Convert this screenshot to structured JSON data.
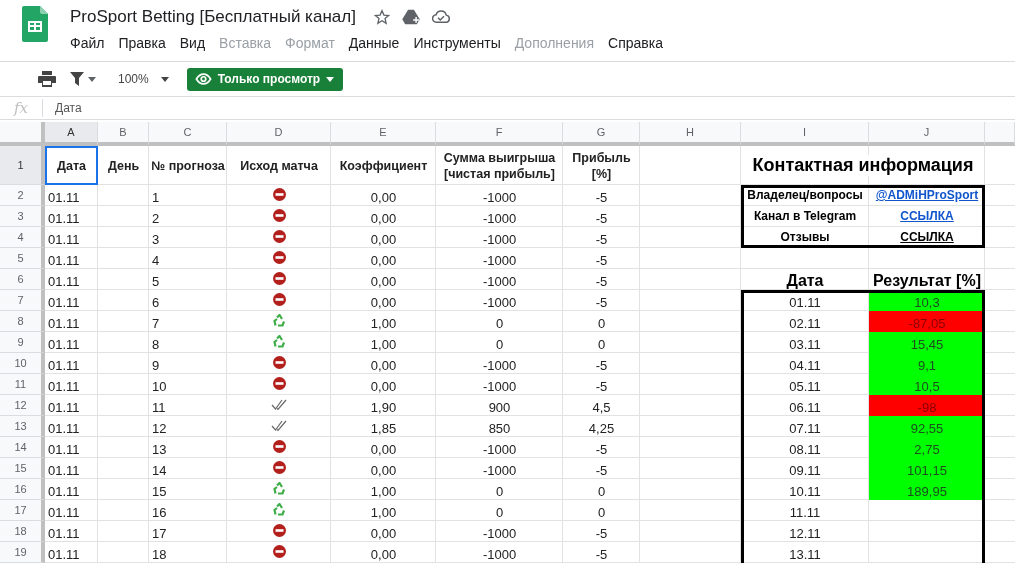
{
  "document": {
    "title": "ProSport Betting [Бесплатный канал]"
  },
  "menu": [
    {
      "label": "Файл",
      "disabled": false
    },
    {
      "label": "Правка",
      "disabled": false
    },
    {
      "label": "Вид",
      "disabled": false
    },
    {
      "label": "Вставка",
      "disabled": true
    },
    {
      "label": "Формат",
      "disabled": true
    },
    {
      "label": "Данные",
      "disabled": false
    },
    {
      "label": "Инструменты",
      "disabled": false
    },
    {
      "label": "Дополнения",
      "disabled": true
    },
    {
      "label": "Справка",
      "disabled": false
    }
  ],
  "toolbar": {
    "zoom": "100%",
    "mode_button": "Только просмотр"
  },
  "formula_bar": {
    "label": "fx",
    "value": "Дата"
  },
  "sheet": {
    "columns": [
      {
        "label": "A",
        "selected": true
      },
      {
        "label": "B",
        "selected": false
      },
      {
        "label": "C",
        "selected": false
      },
      {
        "label": "D",
        "selected": false
      },
      {
        "label": "E",
        "selected": false
      },
      {
        "label": "F",
        "selected": false
      },
      {
        "label": "G",
        "selected": false
      },
      {
        "label": "H",
        "selected": false
      },
      {
        "label": "I",
        "selected": false
      },
      {
        "label": "J",
        "selected": false
      }
    ],
    "row_numbers": [
      {
        "label": "1",
        "selected": true
      },
      {
        "label": "2",
        "selected": false
      },
      {
        "label": "3",
        "selected": false
      },
      {
        "label": "4",
        "selected": false
      },
      {
        "label": "5",
        "selected": false
      },
      {
        "label": "6",
        "selected": false
      },
      {
        "label": "7",
        "selected": false
      },
      {
        "label": "8",
        "selected": false
      },
      {
        "label": "9",
        "selected": false
      },
      {
        "label": "10",
        "selected": false
      },
      {
        "label": "11",
        "selected": false
      },
      {
        "label": "12",
        "selected": false
      },
      {
        "label": "13",
        "selected": false
      },
      {
        "label": "14",
        "selected": false
      },
      {
        "label": "15",
        "selected": false
      },
      {
        "label": "16",
        "selected": false
      },
      {
        "label": "17",
        "selected": false
      },
      {
        "label": "18",
        "selected": false
      },
      {
        "label": "19",
        "selected": false
      }
    ],
    "header": [
      {
        "text": "Дата",
        "selected": true
      },
      {
        "text": "День",
        "selected": false
      },
      {
        "text": "№ прогноза",
        "selected": false
      },
      {
        "text": "Исход матча",
        "selected": false
      },
      {
        "text": "Коэффициент",
        "selected": false
      },
      {
        "text": "Сумма выигрыша [чистая прибыль]",
        "selected": false
      },
      {
        "text": "Прибыль [%]",
        "selected": false
      }
    ],
    "bets": [
      {
        "date": "01.11",
        "number": "1",
        "kind": "loss",
        "odds": "0,00",
        "win_sum": "-1000",
        "profit": "-5"
      },
      {
        "date": "01.11",
        "number": "2",
        "kind": "loss",
        "odds": "0,00",
        "win_sum": "-1000",
        "profit": "-5"
      },
      {
        "date": "01.11",
        "number": "3",
        "kind": "loss",
        "odds": "0,00",
        "win_sum": "-1000",
        "profit": "-5"
      },
      {
        "date": "01.11",
        "number": "4",
        "kind": "loss",
        "odds": "0,00",
        "win_sum": "-1000",
        "profit": "-5"
      },
      {
        "date": "01.11",
        "number": "5",
        "kind": "loss",
        "odds": "0,00",
        "win_sum": "-1000",
        "profit": "-5"
      },
      {
        "date": "01.11",
        "number": "6",
        "kind": "loss",
        "odds": "0,00",
        "win_sum": "-1000",
        "profit": "-5"
      },
      {
        "date": "01.11",
        "number": "7",
        "kind": "refund",
        "odds": "1,00",
        "win_sum": "0",
        "profit": "0"
      },
      {
        "date": "01.11",
        "number": "8",
        "kind": "refund",
        "odds": "1,00",
        "win_sum": "0",
        "profit": "0"
      },
      {
        "date": "01.11",
        "number": "9",
        "kind": "loss",
        "odds": "0,00",
        "win_sum": "-1000",
        "profit": "-5"
      },
      {
        "date": "01.11",
        "number": "10",
        "kind": "loss",
        "odds": "0,00",
        "win_sum": "-1000",
        "profit": "-5"
      },
      {
        "date": "01.11",
        "number": "11",
        "kind": "win",
        "odds": "1,90",
        "win_sum": "900",
        "profit": "4,5"
      },
      {
        "date": "01.11",
        "number": "12",
        "kind": "win",
        "odds": "1,85",
        "win_sum": "850",
        "profit": "4,25"
      },
      {
        "date": "01.11",
        "number": "13",
        "kind": "loss",
        "odds": "0,00",
        "win_sum": "-1000",
        "profit": "-5"
      },
      {
        "date": "01.11",
        "number": "14",
        "kind": "loss",
        "odds": "0,00",
        "win_sum": "-1000",
        "profit": "-5"
      },
      {
        "date": "01.11",
        "number": "15",
        "kind": "refund",
        "odds": "1,00",
        "win_sum": "0",
        "profit": "0"
      },
      {
        "date": "01.11",
        "number": "16",
        "kind": "refund",
        "odds": "1,00",
        "win_sum": "0",
        "profit": "0"
      },
      {
        "date": "01.11",
        "number": "17",
        "kind": "loss",
        "odds": "0,00",
        "win_sum": "-1000",
        "profit": "-5"
      },
      {
        "date": "01.11",
        "number": "18",
        "kind": "loss",
        "odds": "0,00",
        "win_sum": "-1000",
        "profit": "-5"
      }
    ],
    "contacts": {
      "title": "Контактная информация",
      "items": [
        {
          "label": "Владелец/вопросы",
          "value": "@ADMiHProSport",
          "color": "#1155cc"
        },
        {
          "label": "Канал в Telegram",
          "value": "ССЫЛКА",
          "color": "#1155cc"
        },
        {
          "label": "Отзывы",
          "value": "ССЫЛКА",
          "color": "#000000"
        }
      ]
    },
    "results": {
      "columns": [
        "Дата",
        "Результат [%]"
      ],
      "rows": [
        {
          "date": "01.11",
          "value": "10,3",
          "color": "#00ff00"
        },
        {
          "date": "02.11",
          "value": "-87,05",
          "color": "#ff0000"
        },
        {
          "date": "03.11",
          "value": "15,45",
          "color": "#00ff00"
        },
        {
          "date": "04.11",
          "value": "9,1",
          "color": "#00ff00"
        },
        {
          "date": "05.11",
          "value": "10,5",
          "color": "#00ff00"
        },
        {
          "date": "06.11",
          "value": "-98",
          "color": "#ff0000"
        },
        {
          "date": "07.11",
          "value": "92,55",
          "color": "#00ff00"
        },
        {
          "date": "08.11",
          "value": "2,75",
          "color": "#00ff00"
        },
        {
          "date": "09.11",
          "value": "101,15",
          "color": "#00ff00"
        },
        {
          "date": "10.11",
          "value": "189,95",
          "color": "#00ff00"
        },
        {
          "date": "11.11"
        },
        {
          "date": "12.11"
        },
        {
          "date": "13.11"
        }
      ]
    }
  }
}
